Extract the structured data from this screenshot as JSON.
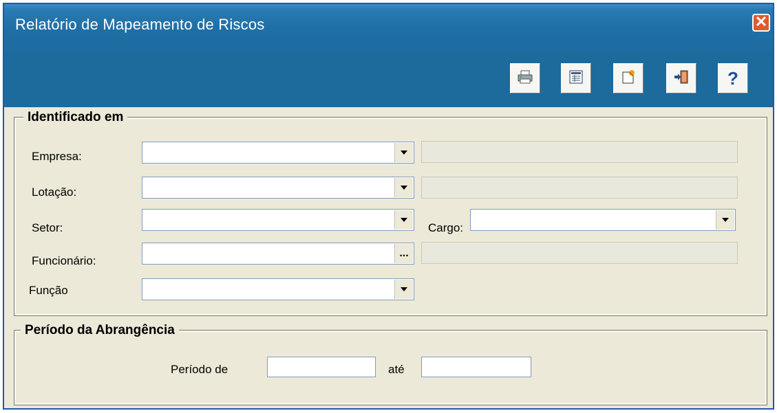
{
  "window": {
    "title": "Relatório de Mapeamento de Riscos",
    "close_label": "✕"
  },
  "toolbar": {
    "buttons": [
      {
        "name": "print-button",
        "icon": "printer-icon"
      },
      {
        "name": "preview-button",
        "icon": "preview-icon"
      },
      {
        "name": "edit-button",
        "icon": "edit-icon"
      },
      {
        "name": "exit-button",
        "icon": "exit-door-icon"
      },
      {
        "name": "help-button",
        "icon": "help-icon",
        "glyph": "?"
      }
    ]
  },
  "identificado": {
    "legend": "Identificado em",
    "empresa_label": "Empresa:",
    "lotacao_label": "Lotação:",
    "setor_label": "Setor:",
    "cargo_label": "Cargo:",
    "funcionario_label": "Funcionário:",
    "funcao_label": "Função",
    "lookup_glyph": "..."
  },
  "periodo": {
    "legend": "Período da Abrangência",
    "de_label": "Período de",
    "ate_label": "até"
  },
  "colors": {
    "titlebar": "#1d6a9d",
    "background": "#ece9d8",
    "close": "#e05a2d"
  }
}
